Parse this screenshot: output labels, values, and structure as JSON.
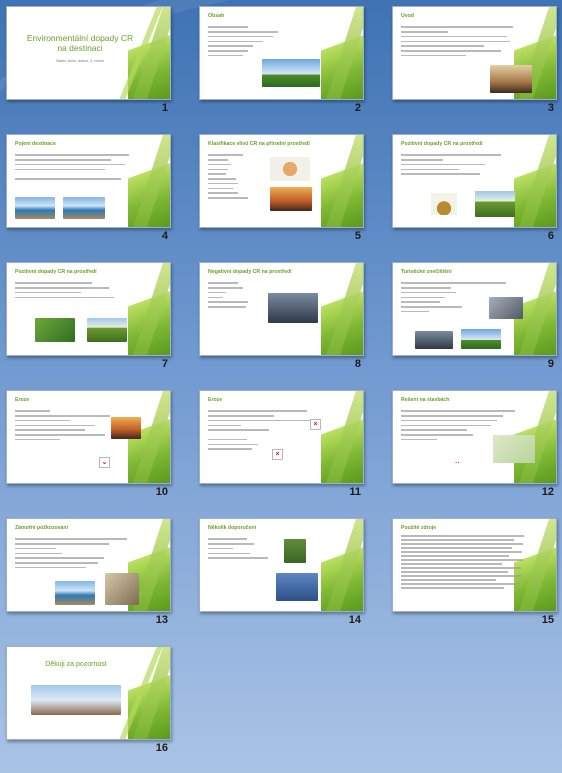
{
  "slides": [
    {
      "num": "1",
      "title": "Environmentální dopady CR na destinaci",
      "subtitle": "Název, Autor, datum, 3. ročník"
    },
    {
      "num": "2",
      "title": "Obsah"
    },
    {
      "num": "3",
      "title": "Úvod"
    },
    {
      "num": "4",
      "title": "Pojem destinace"
    },
    {
      "num": "5",
      "title": "Klasifikace vlivů CR na přírodní prostředí"
    },
    {
      "num": "6",
      "title": "Pozitivní dopady CR na prostředí"
    },
    {
      "num": "7",
      "title": "Pozitivní dopady CR na prostředí"
    },
    {
      "num": "8",
      "title": "Negativní dopady CR na prostředí"
    },
    {
      "num": "9",
      "title": "Turistické znečištění"
    },
    {
      "num": "10",
      "title": "Eroze"
    },
    {
      "num": "11",
      "title": "Eroze"
    },
    {
      "num": "12",
      "title": "Řešení na stavbách"
    },
    {
      "num": "13",
      "title": "Zámořní požkozování"
    },
    {
      "num": "14",
      "title": "Několik doporučení"
    },
    {
      "num": "15",
      "title": "Použité zdroje"
    },
    {
      "num": "16",
      "title": "Děkuji za pozornost"
    }
  ],
  "icons": {
    "broken_image": "broken-image-icon"
  }
}
